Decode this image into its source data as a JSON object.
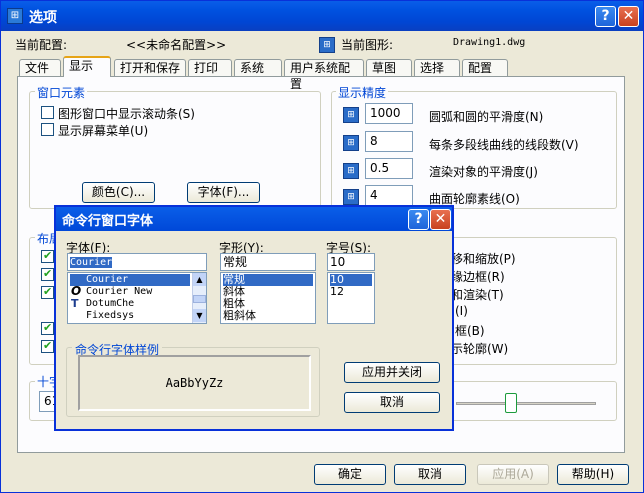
{
  "window": {
    "title": "选项",
    "help": "?",
    "close": "✕"
  },
  "profile": {
    "current_label": "当前配置:",
    "current_value": "<<未命名配置>>",
    "drawing_label": "当前图形:",
    "drawing_value": "Drawing1.dwg"
  },
  "tabs": [
    "文件",
    "显示",
    "打开和保存",
    "打印",
    "系统",
    "用户系统配置",
    "草图",
    "选择",
    "配置"
  ],
  "window_elements": {
    "title": "窗口元素",
    "opt1": "图形窗口中显示滚动条(S)",
    "opt2": "显示屏幕菜单(U)",
    "colors_btn": "颜色(C)...",
    "fonts_btn": "字体(F)..."
  },
  "precision": {
    "title": "显示精度",
    "rows": [
      {
        "value": "1000",
        "label": "圆弧和圆的平滑度(N)"
      },
      {
        "value": "8",
        "label": "每条多段线曲线的线段数(V)"
      },
      {
        "value": "0.5",
        "label": "渲染对象的平滑度(J)"
      },
      {
        "value": "4",
        "label": "曲面轮廓素线(O)"
      }
    ]
  },
  "layout": {
    "title": "布局",
    "right_labels": [
      "移和缩放(P)",
      "缘边框(R)",
      "和渲染(T)",
      "(I)",
      "框(B)",
      "示轮廓(W)"
    ]
  },
  "crosshair": {
    "title": "十字",
    "value": "61"
  },
  "bottom": {
    "ok": "确定",
    "cancel": "取消",
    "apply": "应用(A)",
    "help": "帮助(H)"
  },
  "dialog": {
    "title": "命令行窗口字体",
    "font_label": "字体(F):",
    "font_value": "Courier",
    "fonts": [
      "Courier",
      "Courier New",
      "DotumChe",
      "Fixedsys"
    ],
    "style_label": "字形(Y):",
    "style_value": "常规",
    "styles": [
      "常规",
      "斜体",
      "粗体",
      "粗斜体"
    ],
    "size_label": "字号(S):",
    "size_value": "10",
    "sizes": [
      "10",
      "12"
    ],
    "sample_title": "命令行字体样例",
    "sample": "AaBbYyZz",
    "apply_close": "应用并关闭",
    "cancel": "取消"
  }
}
